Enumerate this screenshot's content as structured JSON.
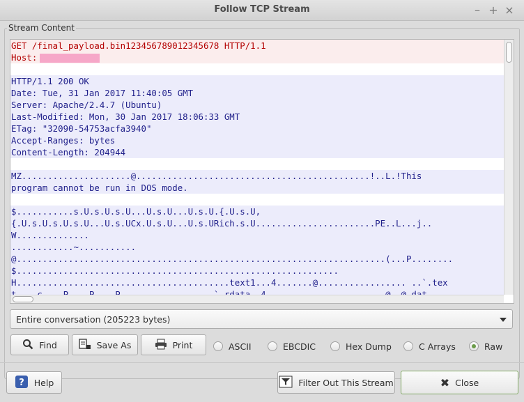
{
  "window": {
    "title": "Follow TCP Stream"
  },
  "group": {
    "label": "Stream Content"
  },
  "stream": {
    "lines": [
      {
        "kind": "client",
        "text": "GET /final_payload.bin123456789012345678 HTTP/1.1"
      },
      {
        "kind": "client",
        "text": "Host:",
        "redacted": true
      },
      {
        "kind": "blank",
        "text": ""
      },
      {
        "kind": "server",
        "text": "HTTP/1.1 200 OK"
      },
      {
        "kind": "server",
        "text": "Date: Tue, 31 Jan 2017 11:40:05 GMT"
      },
      {
        "kind": "server",
        "text": "Server: Apache/2.4.7 (Ubuntu)"
      },
      {
        "kind": "server",
        "text": "Last-Modified: Mon, 30 Jan 2017 18:06:33 GMT"
      },
      {
        "kind": "server",
        "text": "ETag: \"32090-54753acfa3940\""
      },
      {
        "kind": "server",
        "text": "Accept-Ranges: bytes"
      },
      {
        "kind": "server",
        "text": "Content-Length: 204944"
      },
      {
        "kind": "blank",
        "text": ""
      },
      {
        "kind": "server",
        "text": "MZ.....................@.............................................!..L.!This"
      },
      {
        "kind": "server",
        "text": "program cannot be run in DOS mode."
      },
      {
        "kind": "blank",
        "text": ""
      },
      {
        "kind": "server",
        "text": "$...........s.U.s.U.s.U...U.s.U...U.s.U.{.U.s.U,"
      },
      {
        "kind": "server",
        "text": "{.U.s.U.s.U.s.U...U.s.UCx.U.s.U...U.s.URich.s.U.......................PE..L...j.."
      },
      {
        "kind": "server",
        "text": "W.............."
      },
      {
        "kind": "server",
        "text": "............~..........."
      },
      {
        "kind": "server",
        "text": "@.......................................................................(...P........"
      },
      {
        "kind": "server",
        "text": "$.............................................................."
      },
      {
        "kind": "server",
        "text": "H.........................................text1...4.......@................. ..`.tex"
      },
      {
        "kind": "server",
        "text": "t....c....P....P....P..................`.rdata..4.......................@..@.dat"
      }
    ]
  },
  "conversation_select": {
    "value": "Entire conversation (205223 bytes)"
  },
  "buttons": {
    "find": "Find",
    "save_as": "Save As",
    "print": "Print",
    "help": "Help",
    "filter_out": "Filter Out This Stream",
    "close": "Close"
  },
  "formats": [
    {
      "label": "ASCII",
      "selected": false
    },
    {
      "label": "EBCDIC",
      "selected": false
    },
    {
      "label": "Hex Dump",
      "selected": false
    },
    {
      "label": "C Arrays",
      "selected": false
    },
    {
      "label": "Raw",
      "selected": true
    }
  ],
  "colors": {
    "client_text": "#b30000",
    "server_text": "#1f1f8a",
    "redaction": "#f6a7c8",
    "radio_on": "#6c9c4a"
  }
}
